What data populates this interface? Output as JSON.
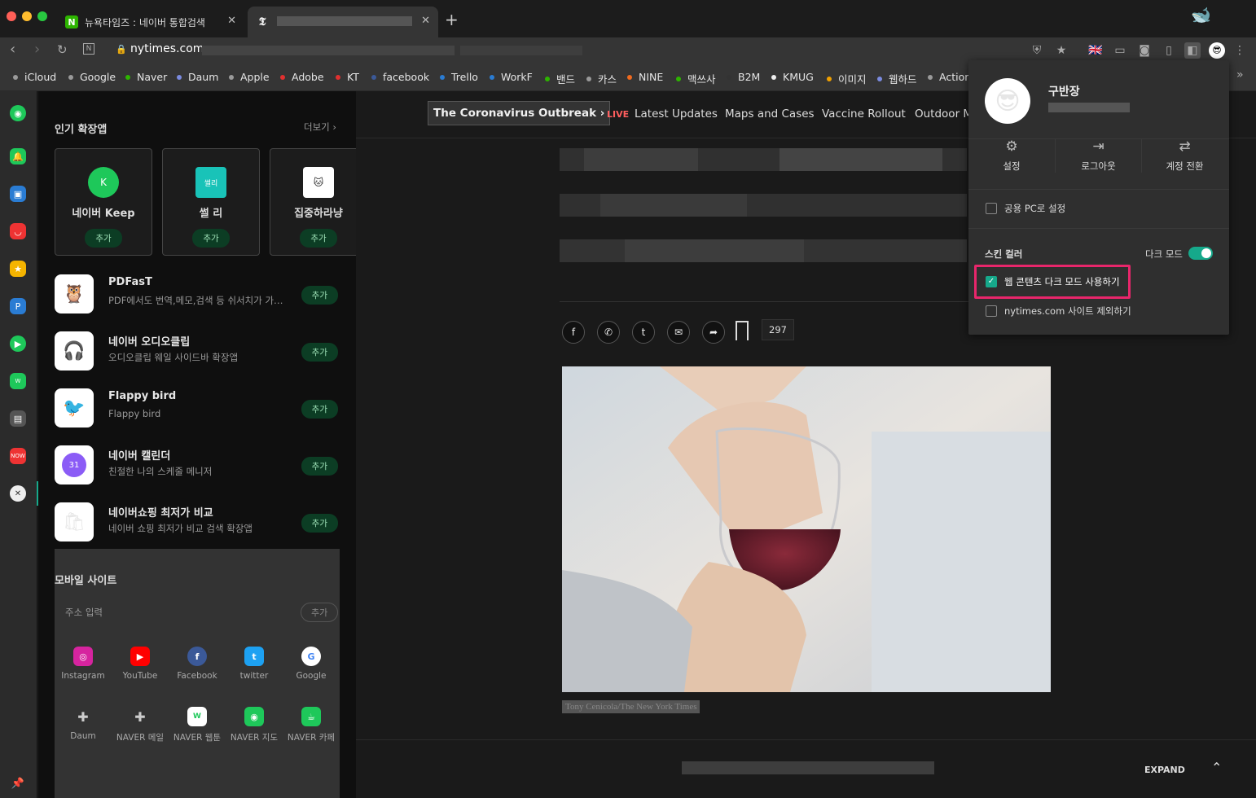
{
  "tabs": [
    {
      "title": "뉴욕타임즈 : 네이버 통합검색",
      "favicon": "N"
    },
    {
      "title": "",
      "favicon": "𝕿"
    }
  ],
  "address": {
    "domain": "nytimes.com"
  },
  "bookmarks": [
    {
      "label": "iCloud",
      "color": "#9a9a9a"
    },
    {
      "label": "Google",
      "color": "#9a9a9a"
    },
    {
      "label": "Naver",
      "color": "#2db400"
    },
    {
      "label": "Daum",
      "color": "#7b8be0"
    },
    {
      "label": "Apple",
      "color": "#9a9a9a"
    },
    {
      "label": "Adobe",
      "color": "#e0302f"
    },
    {
      "label": "KT",
      "color": "#e0302f"
    },
    {
      "label": "facebook",
      "color": "#3b5998"
    },
    {
      "label": "Trello",
      "color": "#2a7cd3"
    },
    {
      "label": "WorkF",
      "color": "#2a7cd3"
    },
    {
      "label": "밴드",
      "color": "#2db400"
    },
    {
      "label": "카스",
      "color": "#9a9a9a"
    },
    {
      "label": "NINE",
      "color": "#f06a1e"
    },
    {
      "label": "맥쓰사",
      "color": "#2db400"
    },
    {
      "label": "B2M",
      "color": "#333"
    },
    {
      "label": "KMUG",
      "color": "#eeeeee"
    },
    {
      "label": "이미지",
      "color": "#f0a000"
    },
    {
      "label": "웹하드",
      "color": "#7b8be0"
    },
    {
      "label": "Action",
      "color": "#9a9a9a"
    }
  ],
  "panel": {
    "popular_title": "인기 확장앱",
    "more": "더보기",
    "add_label": "추가",
    "cards": [
      {
        "name": "네이버 Keep",
        "color": "#1ec85a",
        "glyph": "K"
      },
      {
        "name": "썰 리",
        "color": "#19c3b8",
        "glyph": "썰리"
      },
      {
        "name": "집중하라냥",
        "color": "#ffffff",
        "glyph": "🐱"
      }
    ],
    "items": [
      {
        "title": "PDFasT",
        "desc": "PDF에서도 번역,메모,검색 등 쉬서치가 가능한",
        "glyph": "🦉"
      },
      {
        "title": "네이버 오디오클립",
        "desc": "오디오클립 웨일 사이드바 확장앱",
        "glyph": "🎧"
      },
      {
        "title": "Flappy bird",
        "desc": "Flappy bird",
        "glyph": "🐦"
      },
      {
        "title": "네이버 캘린더",
        "desc": "친절한 나의 스케줄 메니저",
        "glyph": "31"
      },
      {
        "title": "네이버쇼핑 최저가 비교",
        "desc": "네이버 쇼핑 최저가 비교 검색 확장앱",
        "glyph": "🛍"
      }
    ],
    "mobile": {
      "title": "모바일 사이트",
      "placeholder": "주소 입력",
      "add": "추가",
      "sites": [
        {
          "label": "Instagram",
          "color": "#d6249f",
          "glyph": "◎"
        },
        {
          "label": "YouTube",
          "color": "#ff0000",
          "glyph": "▶"
        },
        {
          "label": "Facebook",
          "color": "#3b5998",
          "glyph": "f"
        },
        {
          "label": "twitter",
          "color": "#1da1f2",
          "glyph": "t"
        },
        {
          "label": "Google",
          "color": "#ffffff",
          "glyph": "G"
        },
        {
          "label": "Daum",
          "color": "#333333",
          "glyph": "✚"
        },
        {
          "label": "NAVER 메일",
          "color": "#333333",
          "glyph": "✚"
        },
        {
          "label": "NAVER 웹툰",
          "color": "#ffffff",
          "glyph": "W"
        },
        {
          "label": "NAVER 지도",
          "color": "#1ec85a",
          "glyph": "◉"
        },
        {
          "label": "NAVER 카페",
          "color": "#1ec85a",
          "glyph": "☕"
        }
      ]
    }
  },
  "nyt": {
    "banner": "The Coronavirus Outbreak ›",
    "live": "LIVE",
    "links": [
      "Latest Updates",
      "Maps and Cases",
      "Vaccine Rollout",
      "Outdoor Ma"
    ],
    "comments": "297",
    "caption": "Tony Cenicola/The New York Times",
    "expand": "EXPAND"
  },
  "popup": {
    "user": "구반장",
    "actions": [
      {
        "label": "설정",
        "glyph": "⚙"
      },
      {
        "label": "로그아웃",
        "glyph": "⇥"
      },
      {
        "label": "계정 전환",
        "glyph": "⇄"
      }
    ],
    "public_pc": "공용 PC로 설정",
    "skin_color": "스킨 컬러",
    "dark_mode": "다크 모드",
    "web_dark": "웹 콘텐츠 다크 모드 사용하기",
    "exclude_site": "nytimes.com 사이트 제외하기",
    "accent": "#16a98b",
    "highlight": "#e8266b"
  }
}
